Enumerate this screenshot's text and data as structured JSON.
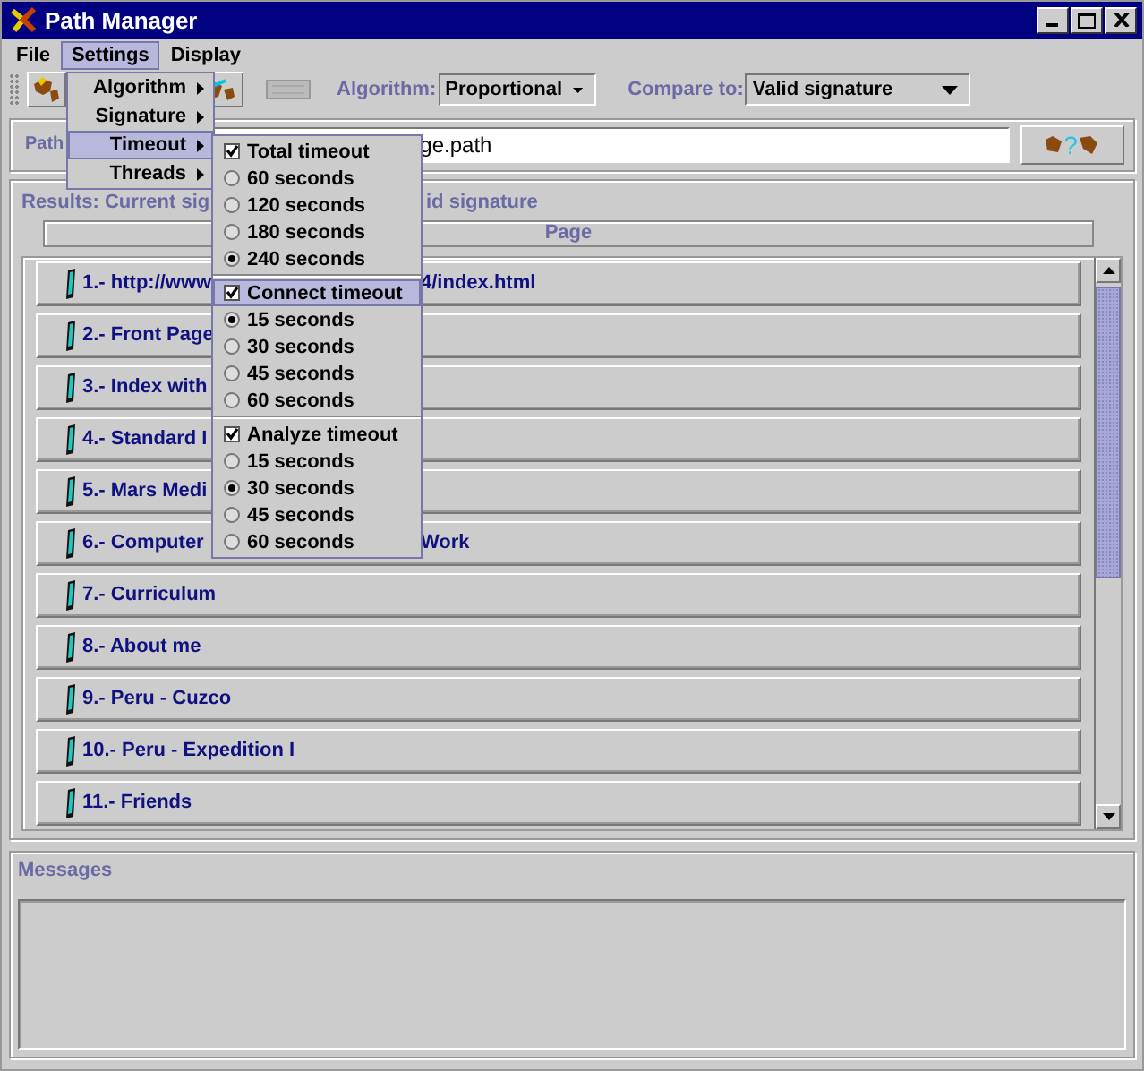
{
  "window": {
    "title": "Path Manager"
  },
  "menubar": [
    {
      "label": "File",
      "selected": false
    },
    {
      "label": "Settings",
      "selected": true
    },
    {
      "label": "Display",
      "selected": false
    }
  ],
  "settings_menu": [
    {
      "label": "Algorithm",
      "selected": false
    },
    {
      "label": "Signature",
      "selected": false
    },
    {
      "label": "Timeout",
      "selected": true
    },
    {
      "label": "Threads",
      "selected": false
    }
  ],
  "timeout_submenu": [
    {
      "kind": "check",
      "label": "Total timeout",
      "checked": true,
      "selected": false
    },
    {
      "kind": "radio",
      "label": "60 seconds",
      "checked": false,
      "selected": false
    },
    {
      "kind": "radio",
      "label": "120 seconds",
      "checked": false,
      "selected": false
    },
    {
      "kind": "radio",
      "label": "180 seconds",
      "checked": false,
      "selected": false
    },
    {
      "kind": "radio",
      "label": "240 seconds",
      "checked": true,
      "selected": false
    },
    {
      "kind": "check",
      "label": "Connect timeout",
      "checked": true,
      "selected": true
    },
    {
      "kind": "radio",
      "label": "15 seconds",
      "checked": true,
      "selected": false
    },
    {
      "kind": "radio",
      "label": "30 seconds",
      "checked": false,
      "selected": false
    },
    {
      "kind": "radio",
      "label": "45 seconds",
      "checked": false,
      "selected": false
    },
    {
      "kind": "radio",
      "label": "60 seconds",
      "checked": false,
      "selected": false
    },
    {
      "kind": "check",
      "label": "Analyze timeout",
      "checked": true,
      "selected": false
    },
    {
      "kind": "radio",
      "label": "15 seconds",
      "checked": false,
      "selected": false
    },
    {
      "kind": "radio",
      "label": "30 seconds",
      "checked": true,
      "selected": false
    },
    {
      "kind": "radio",
      "label": "45 seconds",
      "checked": false,
      "selected": false
    },
    {
      "kind": "radio",
      "label": "60 seconds",
      "checked": false,
      "selected": false
    }
  ],
  "toolbar": {
    "algorithm_label": "Algorithm:",
    "algorithm": "Proportional",
    "compare_label": "Compare to:",
    "compare": "Valid signature"
  },
  "path": {
    "label": "Path",
    "value": "ge.path",
    "help_glyph": "?"
  },
  "results": {
    "label_parts": [
      "Results: Current sig",
      "id signature"
    ],
    "column": "Page",
    "rows": [
      {
        "parts": [
          "1.- http://www",
          "4/index.html"
        ]
      },
      {
        "parts": [
          "2.- Front Page"
        ]
      },
      {
        "parts": [
          "3.- Index with"
        ]
      },
      {
        "parts": [
          "4.- Standard I"
        ]
      },
      {
        "parts": [
          "5.- Mars Medi"
        ]
      },
      {
        "parts": [
          "6.- Computer",
          "Work"
        ]
      },
      {
        "parts": [
          "7.- Curriculum"
        ]
      },
      {
        "parts": [
          "8.- About me"
        ]
      },
      {
        "parts": [
          "9.- Peru - Cuzco"
        ]
      },
      {
        "parts": [
          "10.- Peru - Expedition I"
        ]
      },
      {
        "parts": [
          "11.- Friends"
        ]
      }
    ]
  },
  "messages": {
    "label": "Messages"
  }
}
